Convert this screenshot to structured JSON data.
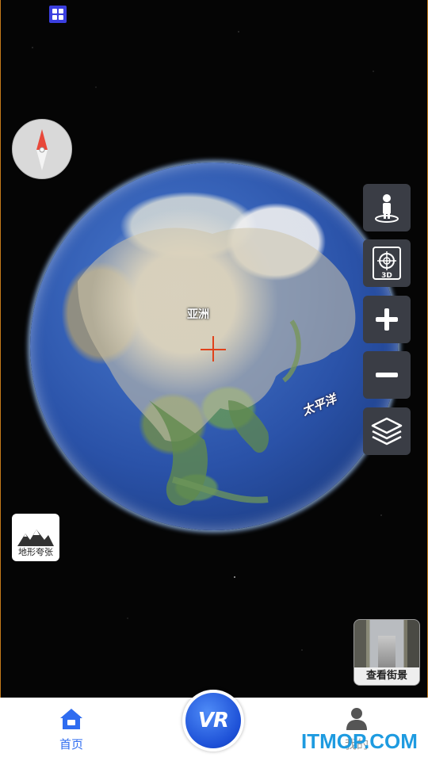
{
  "map": {
    "label_asia": "亚洲",
    "label_pacific": "太平洋"
  },
  "controls": {
    "pegman": "pegman-icon",
    "view_3d": "3D",
    "zoom_in": "plus-icon",
    "zoom_out": "minus-icon",
    "layers": "layers-icon"
  },
  "terrain": {
    "label": "地形夸张"
  },
  "streetview": {
    "label": "查看街景"
  },
  "tabs": {
    "home": "首页",
    "mine": "我的"
  },
  "vr": {
    "label": "VR"
  },
  "watermark": "ITMOP.COM",
  "colors": {
    "accent": "#2f6cf0",
    "control_bg": "#3a3d45",
    "crosshair": "#e0421b"
  }
}
